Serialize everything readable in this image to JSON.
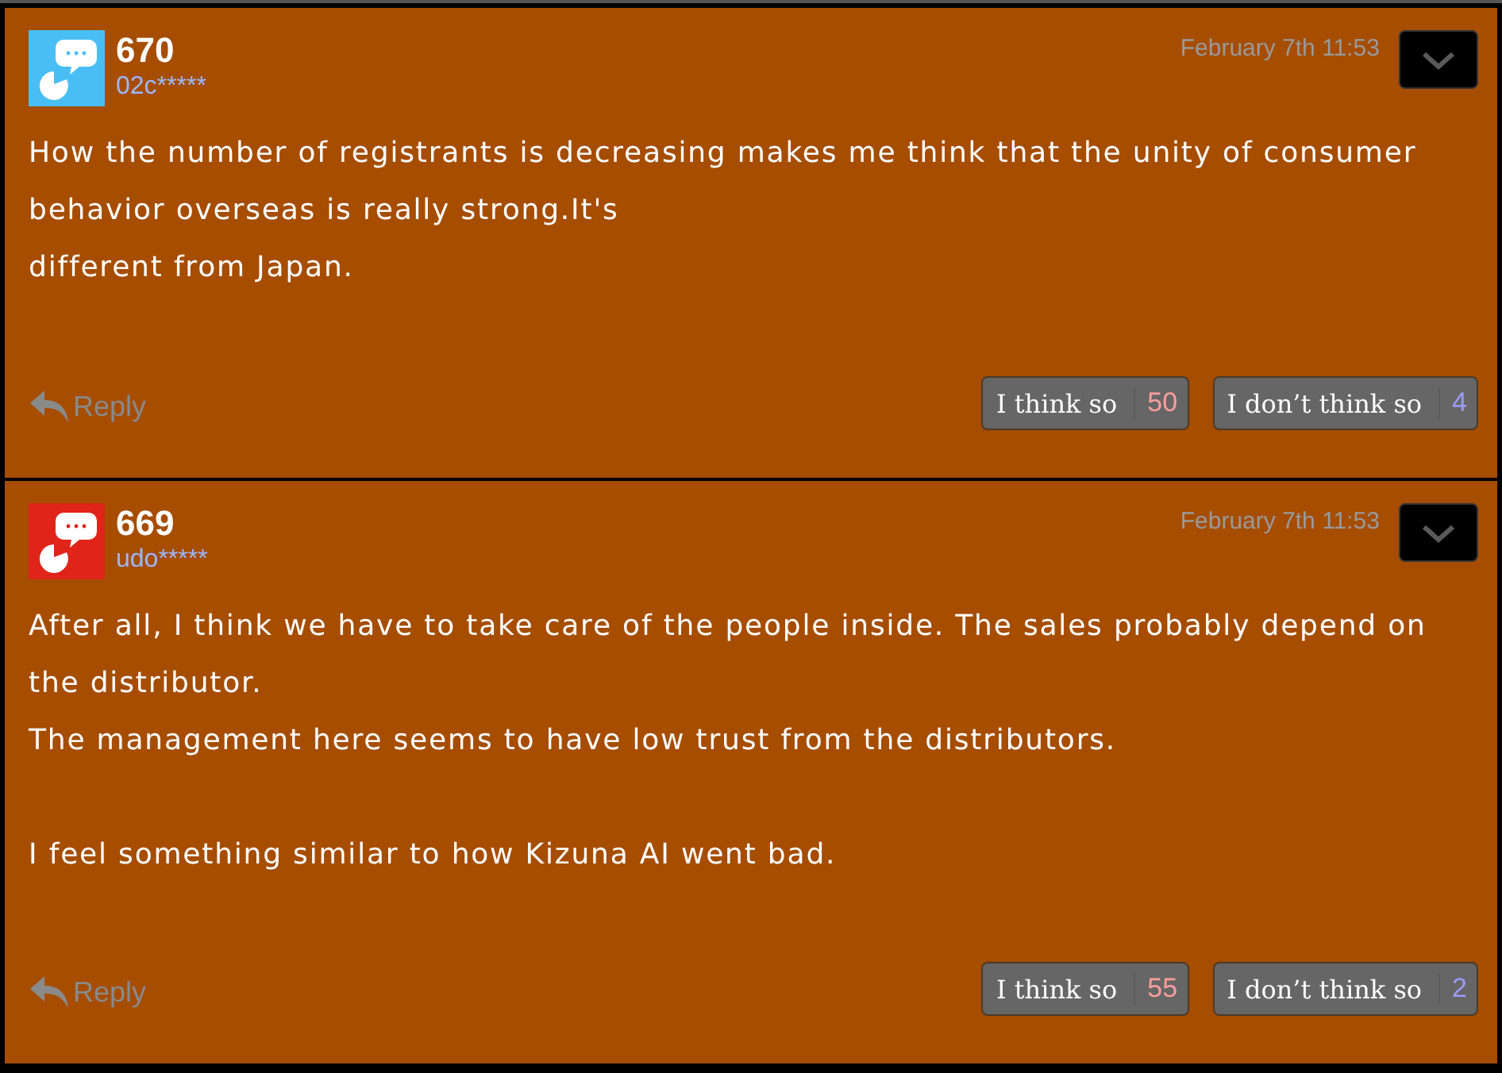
{
  "posts": [
    {
      "number": "670",
      "user": "02c*****",
      "color": "#48bef5",
      "date": "February 7th 11:53",
      "paragraphs": [
        [
          "How the number of registrants is decreasing makes me think that the unity of consumer behavior overseas is really strong.It's",
          "different from Japan."
        ]
      ],
      "reply": "Reply",
      "agree": {
        "label": "I think so",
        "count": "50"
      },
      "disagree": {
        "label": "I don’t think so",
        "count": "4"
      }
    },
    {
      "number": "669",
      "user": "udo*****",
      "color": "#e0241a",
      "date": "February 7th 11:53",
      "paragraphs": [
        [
          "After all, I think we have to take care of the people inside. The sales probably depend on the distributor.",
          "The management here seems to have low trust from the distributors."
        ],
        [
          "I feel something similar to how Kizuna AI went bad."
        ]
      ],
      "reply": "Reply",
      "agree": {
        "label": "I think so",
        "count": "55"
      },
      "disagree": {
        "label": "I don’t think so",
        "count": "2"
      }
    }
  ]
}
